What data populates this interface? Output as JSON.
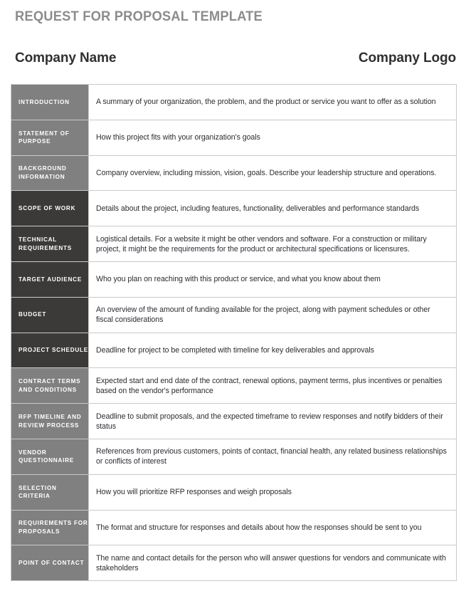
{
  "document": {
    "title": "REQUEST FOR PROPOSAL TEMPLATE",
    "header": {
      "company_name": "Company Name",
      "company_logo": "Company Logo"
    },
    "colors": {
      "title_gray": "#8c8c8c",
      "label_mid_gray": "#808080",
      "label_dark_gray": "#3c3a39",
      "body_text": "#2c2c34",
      "border": "#c9c9c9",
      "label_text": "#ffffff"
    }
  },
  "table": {
    "rows": [
      {
        "label": "INTRODUCTION",
        "description": "A summary of your organization, the problem, and the product or service you want to offer as a solution",
        "shade": "mid"
      },
      {
        "label": "STATEMENT OF PURPOSE",
        "description": "How this project fits with your organization's goals",
        "shade": "mid"
      },
      {
        "label": "BACKGROUND INFORMATION",
        "description": "Company overview, including mission, vision, goals. Describe your leadership structure and operations.",
        "shade": "mid"
      },
      {
        "label": "SCOPE OF WORK",
        "description": "Details about the project, including features, functionality, deliverables and performance standards",
        "shade": "dark"
      },
      {
        "label": "TECHNICAL REQUIREMENTS",
        "description": "Logistical details. For a website it might be other vendors and software. For a construction or military project, it might be the requirements for the product or architectural specifications or licensures.",
        "shade": "dark"
      },
      {
        "label": "TARGET AUDIENCE",
        "description": "Who you plan on reaching with this product or service, and what you know about them",
        "shade": "dark"
      },
      {
        "label": "BUDGET",
        "description": "An overview of the amount of funding available for the project, along with payment schedules or other fiscal considerations",
        "shade": "dark"
      },
      {
        "label": "PROJECT SCHEDULE",
        "description": "Deadline for project to be completed with timeline for key deliverables and approvals",
        "shade": "dark"
      },
      {
        "label": "CONTRACT TERMS AND CONDITIONS",
        "description": "Expected start and end date of the contract, renewal options, payment terms, plus incentives or penalties based on the vendor's performance",
        "shade": "mid"
      },
      {
        "label": "RFP TIMELINE AND REVIEW PROCESS",
        "description": "Deadline to submit proposals, and the expected timeframe to review responses and notify bidders of their status",
        "shade": "mid"
      },
      {
        "label": "VENDOR QUESTIONNAIRE",
        "description": "References from previous customers, points of contact, financial health, any related business relationships or conflicts of interest",
        "shade": "mid"
      },
      {
        "label": "SELECTION CRITERIA",
        "description": "How you will prioritize RFP responses and weigh proposals",
        "shade": "mid"
      },
      {
        "label": "REQUIREMENTS FOR PROPOSALS",
        "description": "The format and structure for responses and details about how the responses should be sent to you",
        "shade": "mid"
      },
      {
        "label": "POINT OF CONTACT",
        "description": "The name and contact details for the person who will answer questions for vendors and communicate with stakeholders",
        "shade": "mid"
      }
    ]
  }
}
